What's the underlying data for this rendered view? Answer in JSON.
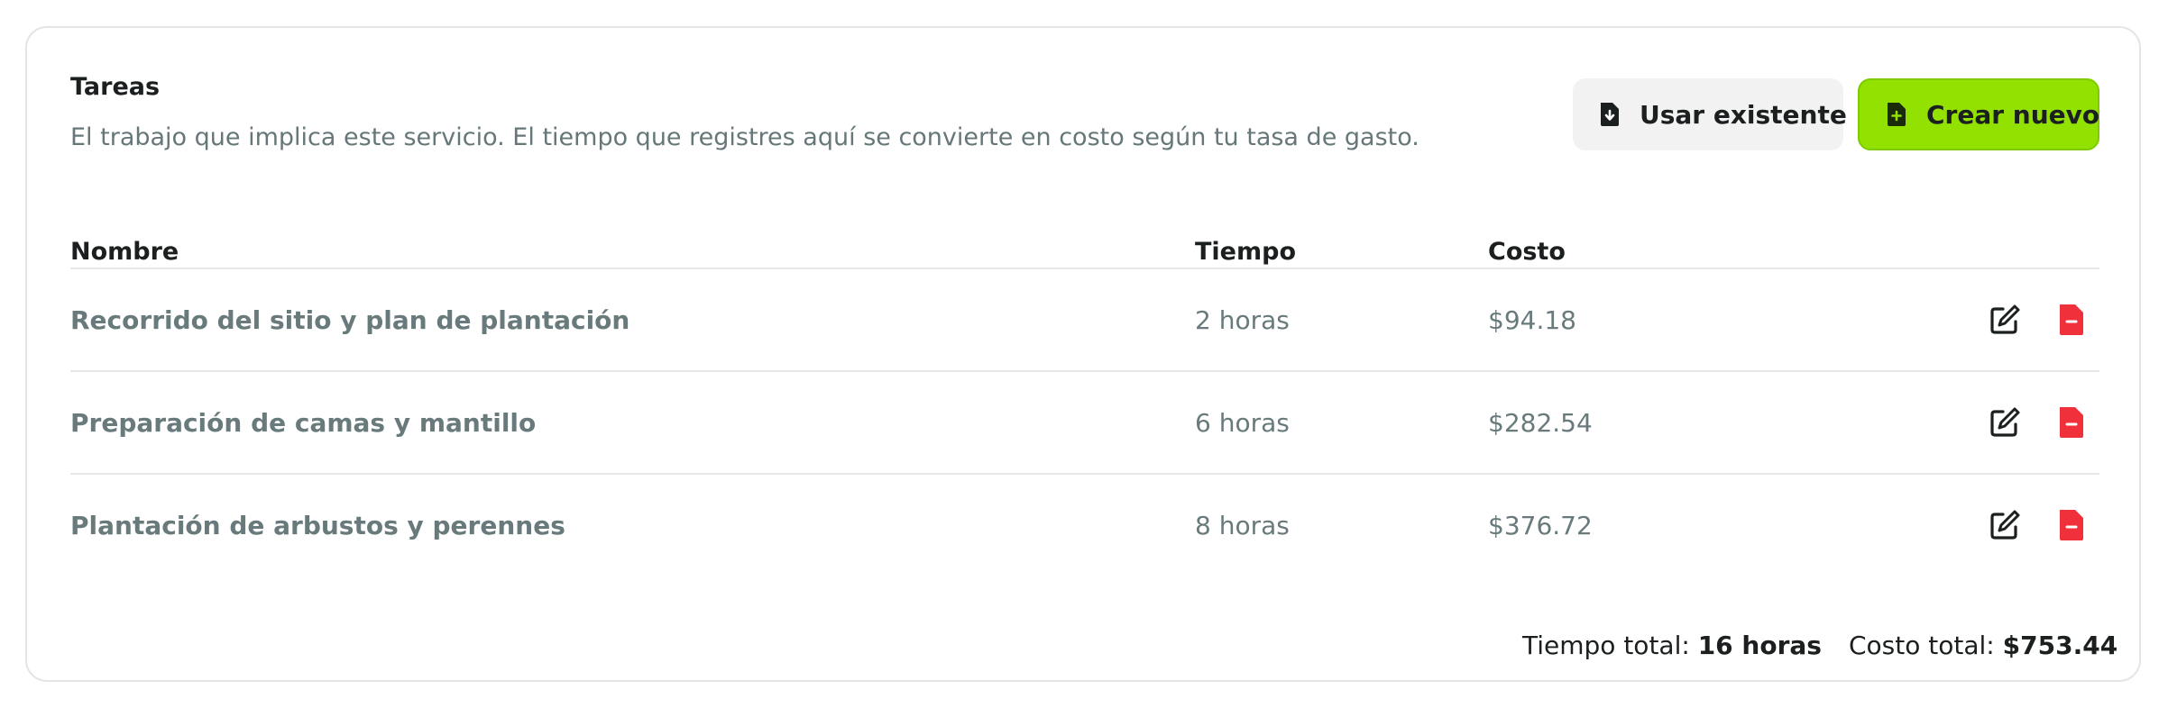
{
  "section": {
    "title": "Tareas",
    "description": "El trabajo que implica este servicio. El tiempo que registres aquí se convierte en costo según tu tasa de gasto."
  },
  "actions": {
    "use_existing_label": "Usar existente",
    "use_existing_icon": "file-download-icon",
    "create_new_label": "Crear nuevo",
    "create_new_icon": "file-plus-icon"
  },
  "table": {
    "columns": {
      "name": "Nombre",
      "time": "Tiempo",
      "cost": "Costo"
    },
    "rows": [
      {
        "name": "Recorrido del sitio y plan de plantación",
        "time": "2 horas",
        "cost": "$94.18"
      },
      {
        "name": "Preparación de camas y mantillo",
        "time": "6 horas",
        "cost": "$282.54"
      },
      {
        "name": "Plantación de arbustos y perennes",
        "time": "8 horas",
        "cost": "$376.72"
      }
    ],
    "row_icons": {
      "edit": "edit-icon",
      "delete": "file-minus-icon"
    }
  },
  "totals": {
    "time_label": "Tiempo total:",
    "time_value": "16 horas",
    "cost_label": "Costo total:",
    "cost_value": "$753.44"
  },
  "colors": {
    "accent_green": "#93e100",
    "delete_red": "#f0303a",
    "muted_text": "#687a7c"
  }
}
